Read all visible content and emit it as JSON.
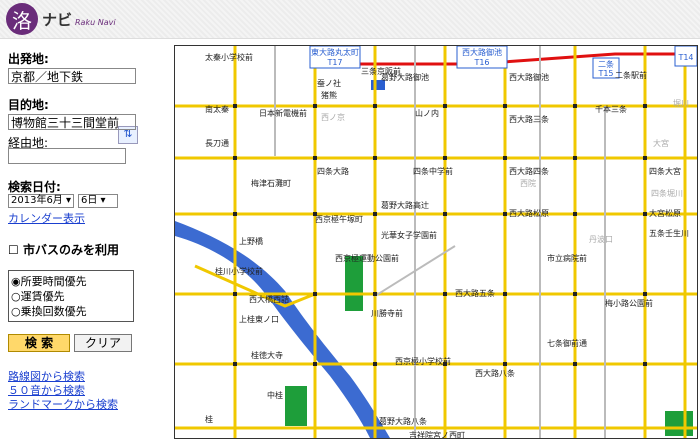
{
  "header": {
    "logo_char": "洛",
    "logo_name": "ナビ",
    "logo_sub": "Raku Navi"
  },
  "form": {
    "from_label": "出発地:",
    "from_value": "京都／地下鉄",
    "swap_icon": "swap-icon",
    "to_label": "目的地:",
    "to_value": "博物館三十三間堂前",
    "via_label": "経由地:",
    "via_value": "",
    "date_label": "検索日付:",
    "year": "2013年6月",
    "day": "6日",
    "calendar_link": "カレンダー表示",
    "citybus_only": "市バスのみを利用",
    "sort_options": [
      "所要時間優先",
      "運賃優先",
      "乗換回数優先"
    ],
    "selected_sort": 0,
    "search_button": "検 索",
    "clear_button": "クリア",
    "links": [
      "路線図から検索",
      "５０音から検索",
      "ランドマークから検索"
    ]
  },
  "map": {
    "badges": [
      {
        "top": "東大路丸太町",
        "bottom": "T17"
      },
      {
        "top": "西大路御池",
        "bottom": "T16"
      },
      {
        "top": "二条",
        "bottom": "T15"
      },
      {
        "top": "",
        "bottom": "T14"
      }
    ],
    "stops": [
      "太秦小学校前",
      "三条京阪前",
      "蚕ノ社",
      "葛野大路御池",
      "西大路御池",
      "二条駅前",
      "南太秦",
      "猪熊",
      "西ノ京",
      "山ノ内",
      "西大路三条",
      "千本三条",
      "長刀通",
      "日本新電機前",
      "四条大路",
      "西院",
      "四条中学前",
      "西大路四条",
      "四条大宮",
      "梅津石灘町",
      "葛野大路高辻",
      "光華女子学園前",
      "西大路松原",
      "大宮松原",
      "五条壬生川",
      "上野橋",
      "西京極午塚町",
      "西京極運動公園前",
      "西大路五条",
      "市立病院前",
      "七条御前通",
      "桂川小学校前",
      "西大橋西詰",
      "上桂東ノ口",
      "川勝寺前",
      "西京極小学校前",
      "梅小路公園前",
      "西大路八条",
      "桂徳大寺",
      "中桂",
      "葛野大路八条",
      "吉祥院宮ノ西町",
      "桂",
      "丹波口",
      "大宮",
      "堀川",
      "四条堀川"
    ]
  }
}
